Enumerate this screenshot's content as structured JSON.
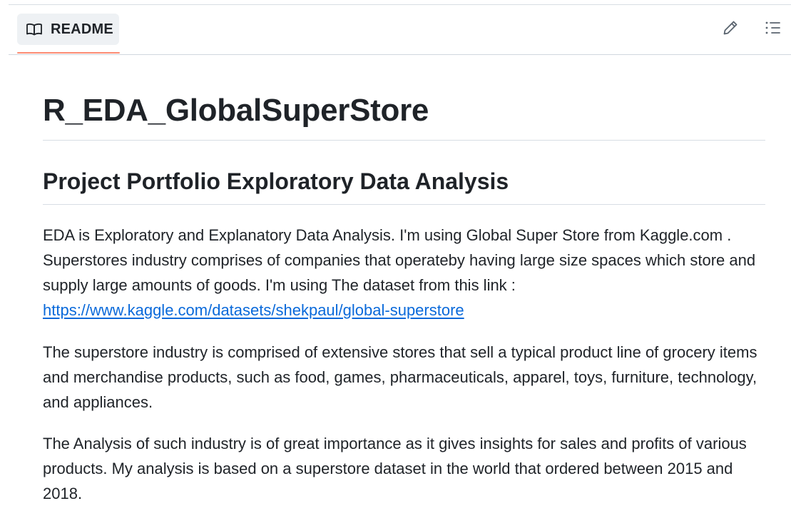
{
  "readme_header": {
    "tab_label": "README",
    "icons": {
      "tab": "book-icon",
      "edit": "pencil-icon",
      "outline": "list-icon"
    },
    "accent_color": "#fd8c73"
  },
  "readme": {
    "title": "R_EDA_GlobalSuperStore",
    "subtitle": "Project Portfolio Exploratory Data Analysis",
    "paragraph1": {
      "text": "EDA is Exploratory and Explanatory Data Analysis. I'm using Global Super Store from Kaggle.com . Superstores industry comprises of companies that operateby having large size spaces which store and supply large amounts of goods. I'm using The dataset from this link :",
      "link_text": "https://www.kaggle.com/datasets/shekpaul/global-superstore",
      "link_color": "#0969da"
    },
    "paragraph2": "The superstore industry is comprised of extensive stores that sell a typical product line of grocery items and merchandise products, such as food, games, pharmaceuticals, apparel, toys, furniture, technology, and appliances.",
    "paragraph3": "The Analysis of such industry is of great importance as it gives insights for sales and profits of various products. My analysis is based on a superstore dataset in the world that ordered between 2015 and 2018."
  }
}
